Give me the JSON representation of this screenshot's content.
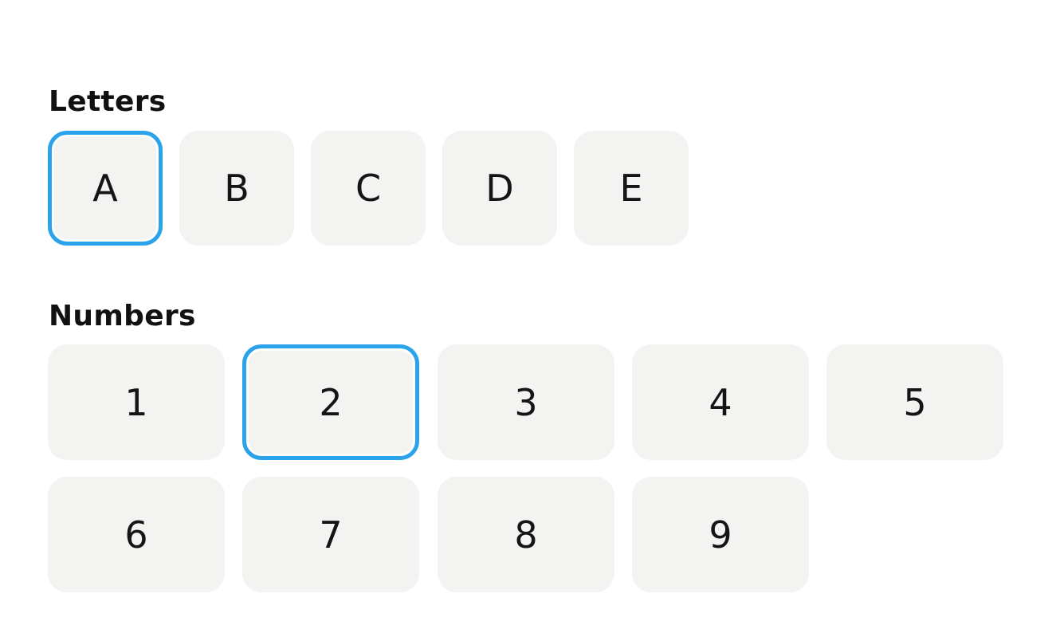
{
  "letters": {
    "title": "Letters",
    "items": [
      "A",
      "B",
      "C",
      "D",
      "E"
    ],
    "selected": "A"
  },
  "numbers": {
    "title": "Numbers",
    "items": [
      "1",
      "2",
      "3",
      "4",
      "5",
      "6",
      "7",
      "8",
      "9"
    ],
    "selected": "2"
  },
  "colors": {
    "selection_border": "#2aa3eb",
    "chip_background": "#f3f3f2",
    "text": "#111111"
  }
}
